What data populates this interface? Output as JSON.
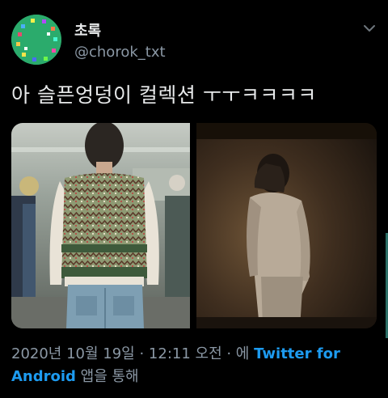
{
  "user": {
    "display_name": "초록",
    "handle": "@chorok_txt",
    "avatar_color": "#2bab6c"
  },
  "tweet": {
    "text": "아 슬픈엉덩이 컬렉션 ㅜㅜㅋㅋㅋㅋ",
    "media": [
      {
        "icon": "photo-knit-vest-back"
      },
      {
        "icon": "photo-dark-figure-back"
      }
    ]
  },
  "meta": {
    "date": "2020년 10월 19일",
    "sep1": " · ",
    "time": "12:11 오전",
    "sep2": " · 에 ",
    "source": "Twitter for Android",
    "suffix": " 앱을 통해"
  },
  "colors": {
    "background": "#000000",
    "text": "#e7e9ea",
    "secondary": "#8b98a5",
    "link": "#1d9bf0"
  },
  "icons": {
    "more": "chevron-down-icon"
  }
}
